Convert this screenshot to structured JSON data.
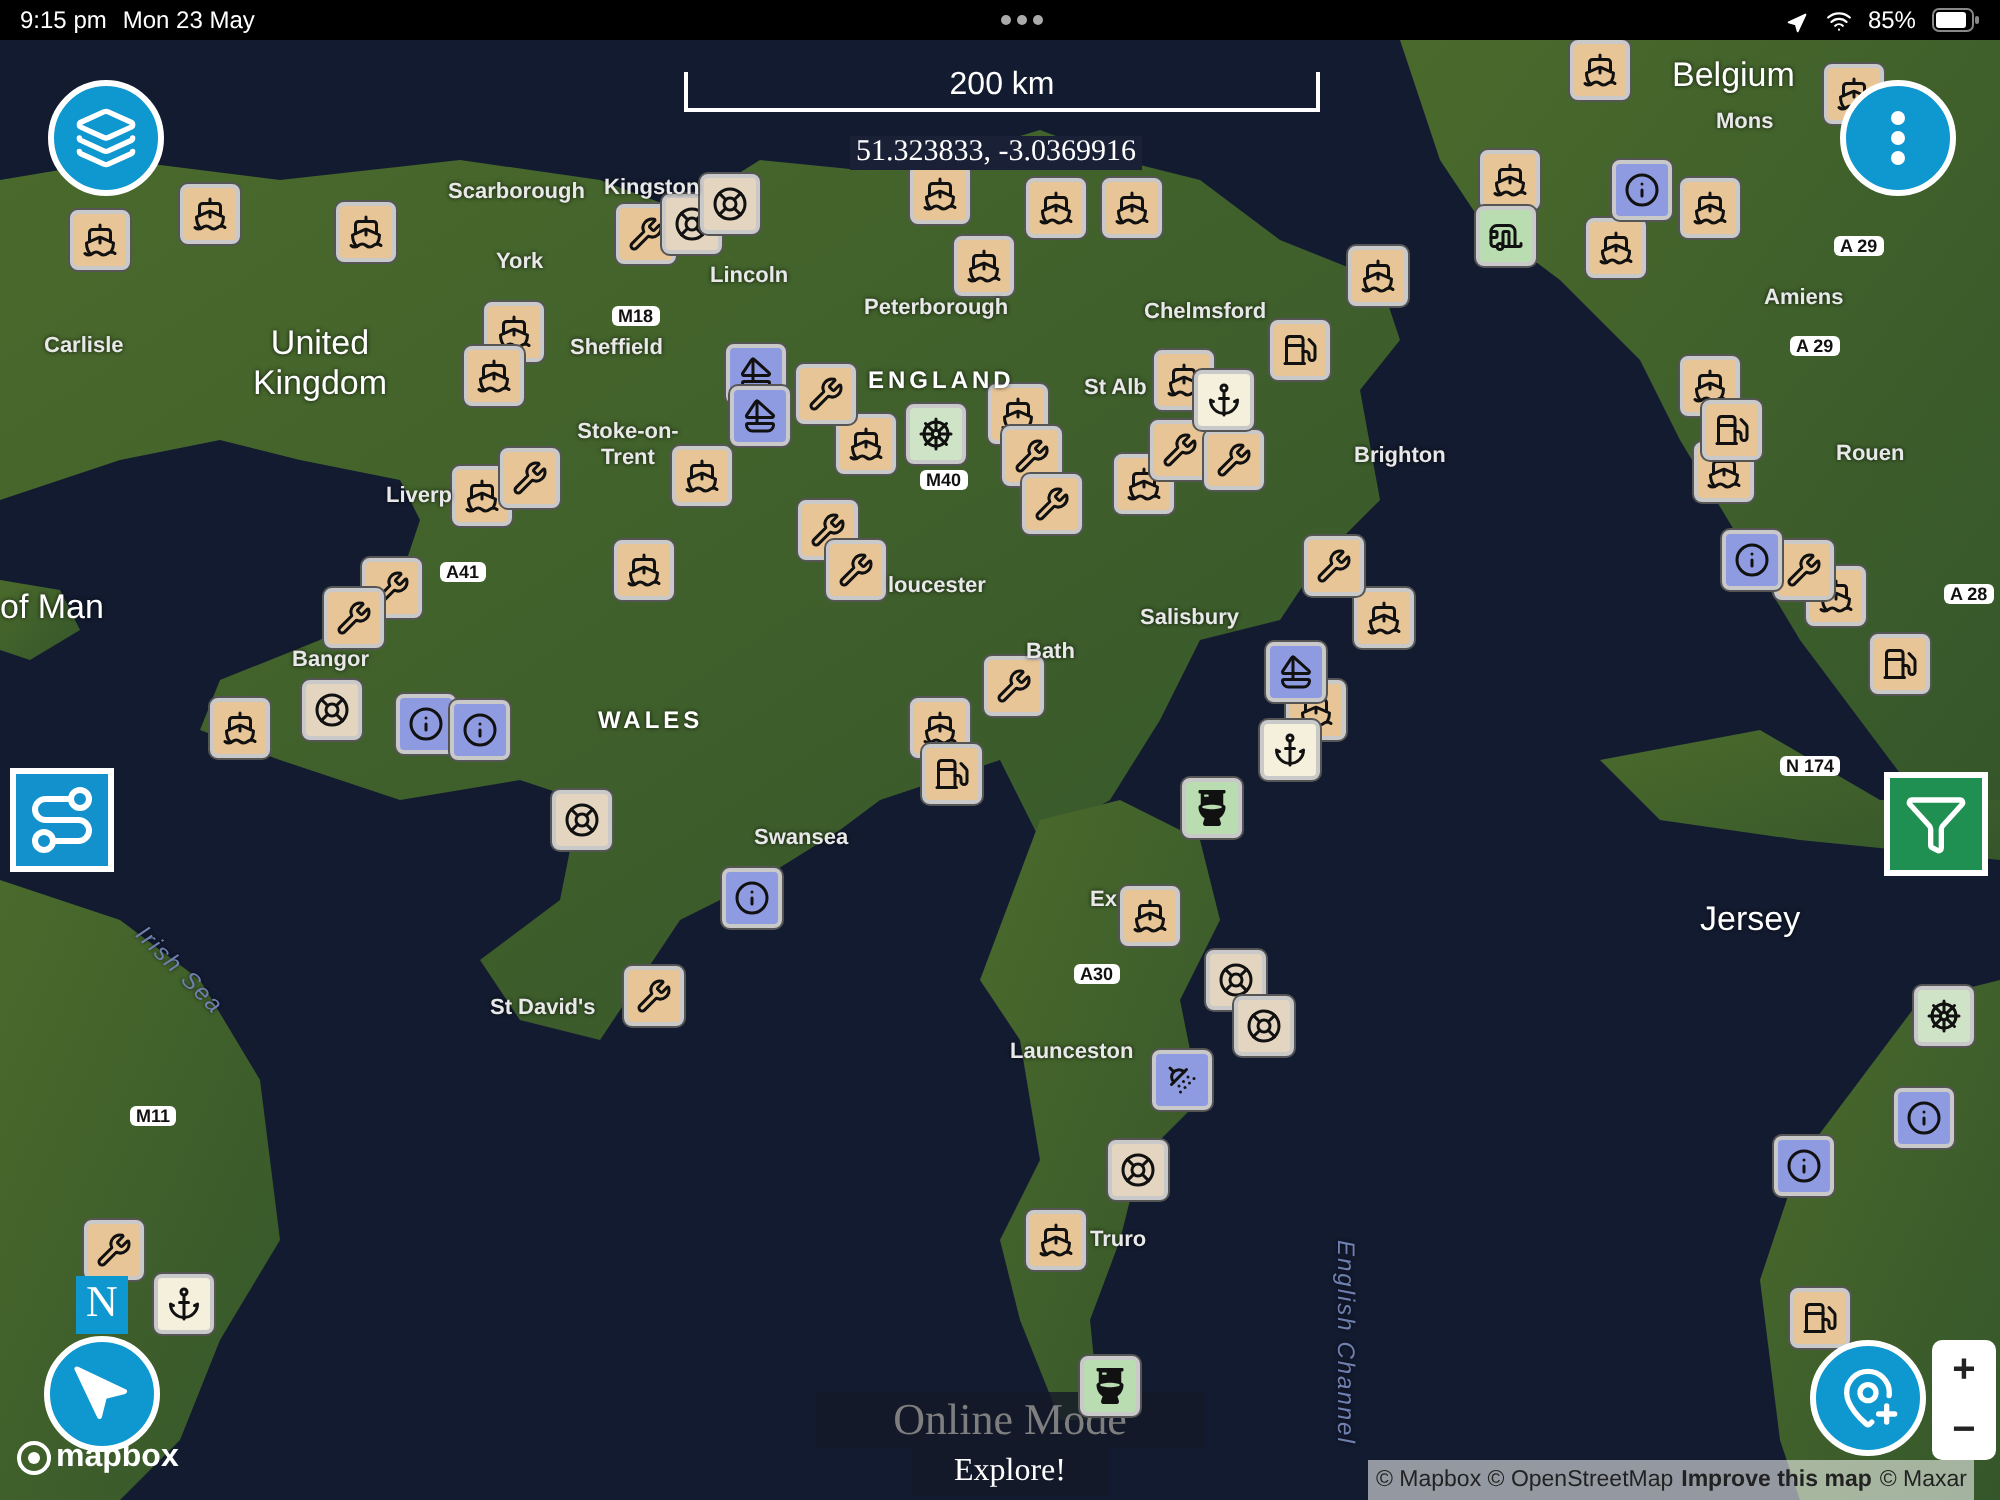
{
  "status_bar": {
    "time": "9:15 pm",
    "date": "Mon 23 May",
    "battery": "85%"
  },
  "scale": {
    "label": "200 km"
  },
  "coordinates": "51.323833, -3.0369916",
  "places": [
    {
      "text": "Scarborough",
      "kind": "town"
    },
    {
      "text": "Kingston",
      "kind": "town"
    },
    {
      "text": "York",
      "kind": "town"
    },
    {
      "text": "Lincoln",
      "kind": "town"
    },
    {
      "text": "Carlisle",
      "kind": "town"
    },
    {
      "text": "United Kingdom",
      "kind": "country"
    },
    {
      "text": "Sheffield",
      "kind": "town"
    },
    {
      "text": "Peterborough",
      "kind": "town"
    },
    {
      "text": "Chelmsford",
      "kind": "town"
    },
    {
      "text": "ENGLAND",
      "kind": "region"
    },
    {
      "text": "St Alb",
      "kind": "town"
    },
    {
      "text": "Stoke-on-Trent",
      "kind": "town"
    },
    {
      "text": "Liverp",
      "kind": "town"
    },
    {
      "text": "loucester",
      "kind": "town"
    },
    {
      "text": "of Man",
      "kind": "country"
    },
    {
      "text": "Bangor",
      "kind": "town"
    },
    {
      "text": "WALES",
      "kind": "region"
    },
    {
      "text": "Bath",
      "kind": "town"
    },
    {
      "text": "Salisbury",
      "kind": "town"
    },
    {
      "text": "Brighton",
      "kind": "town"
    },
    {
      "text": "Swansea",
      "kind": "town"
    },
    {
      "text": "St David's",
      "kind": "town"
    },
    {
      "text": "Ex",
      "kind": "town"
    },
    {
      "text": "Launceston",
      "kind": "town"
    },
    {
      "text": "Truro",
      "kind": "town"
    },
    {
      "text": "Irish Sea",
      "kind": "sea"
    },
    {
      "text": "English Channel",
      "kind": "sea"
    },
    {
      "text": "Belgium",
      "kind": "country"
    },
    {
      "text": "Mons",
      "kind": "town"
    },
    {
      "text": "Amiens",
      "kind": "town"
    },
    {
      "text": "Rouen",
      "kind": "town"
    },
    {
      "text": "Jersey",
      "kind": "country"
    },
    {
      "text": "M18",
      "kind": "road"
    },
    {
      "text": "M40",
      "kind": "road"
    },
    {
      "text": "A41",
      "kind": "road"
    },
    {
      "text": "M11",
      "kind": "road"
    },
    {
      "text": "A30",
      "kind": "road"
    },
    {
      "text": "A 29",
      "kind": "road"
    },
    {
      "text": "A 29",
      "kind": "road"
    },
    {
      "text": "A 28",
      "kind": "road"
    },
    {
      "text": "N 174",
      "kind": "road"
    }
  ],
  "markers": [
    {
      "kind": "harbour"
    },
    {
      "kind": "harbour"
    },
    {
      "kind": "harbour"
    },
    {
      "kind": "harbour"
    },
    {
      "kind": "harbour"
    },
    {
      "kind": "harbour"
    },
    {
      "kind": "harbour"
    },
    {
      "kind": "harbour"
    },
    {
      "kind": "harbour"
    },
    {
      "kind": "harbour"
    },
    {
      "kind": "harbour"
    },
    {
      "kind": "harbour"
    },
    {
      "kind": "harbour"
    },
    {
      "kind": "harbour"
    },
    {
      "kind": "harbour"
    },
    {
      "kind": "harbour"
    },
    {
      "kind": "harbour"
    },
    {
      "kind": "harbour"
    },
    {
      "kind": "harbour"
    },
    {
      "kind": "harbour"
    },
    {
      "kind": "harbour"
    },
    {
      "kind": "harbour"
    },
    {
      "kind": "harbour"
    },
    {
      "kind": "harbour"
    },
    {
      "kind": "harbour"
    },
    {
      "kind": "harbour"
    },
    {
      "kind": "harbour"
    },
    {
      "kind": "harbour"
    },
    {
      "kind": "harbour"
    },
    {
      "kind": "harbour"
    },
    {
      "kind": "harbour"
    },
    {
      "kind": "repair"
    },
    {
      "kind": "repair"
    },
    {
      "kind": "repair"
    },
    {
      "kind": "repair"
    },
    {
      "kind": "repair"
    },
    {
      "kind": "repair"
    },
    {
      "kind": "repair"
    },
    {
      "kind": "repair"
    },
    {
      "kind": "repair"
    },
    {
      "kind": "repair"
    },
    {
      "kind": "repair"
    },
    {
      "kind": "repair"
    },
    {
      "kind": "repair"
    },
    {
      "kind": "repair"
    },
    {
      "kind": "repair"
    },
    {
      "kind": "repair"
    },
    {
      "kind": "info"
    },
    {
      "kind": "info"
    },
    {
      "kind": "info"
    },
    {
      "kind": "info"
    },
    {
      "kind": "info"
    },
    {
      "kind": "info"
    },
    {
      "kind": "info"
    },
    {
      "kind": "sailing"
    },
    {
      "kind": "sailing"
    },
    {
      "kind": "sailing"
    },
    {
      "kind": "fuel"
    },
    {
      "kind": "fuel"
    },
    {
      "kind": "fuel"
    },
    {
      "kind": "fuel"
    },
    {
      "kind": "fuel"
    },
    {
      "kind": "anchorage"
    },
    {
      "kind": "anchorage"
    },
    {
      "kind": "anchorage"
    },
    {
      "kind": "toilet"
    },
    {
      "kind": "toilet"
    },
    {
      "kind": "shower"
    },
    {
      "kind": "buoy"
    },
    {
      "kind": "buoy"
    },
    {
      "kind": "buoy"
    },
    {
      "kind": "buoy"
    },
    {
      "kind": "buoy"
    },
    {
      "kind": "buoy"
    },
    {
      "kind": "buoy"
    },
    {
      "kind": "wheel"
    },
    {
      "kind": "wheel"
    },
    {
      "kind": "caravan"
    }
  ],
  "north": "N",
  "attribution": {
    "credits": "© Mapbox © OpenStreetMap",
    "link": "Improve this map",
    "imagery": "© Maxar"
  },
  "logo": "mapbox",
  "mode": {
    "title": "Online Mode",
    "subtitle": "Explore!"
  },
  "zoom": {
    "in": "+",
    "out": "−"
  }
}
